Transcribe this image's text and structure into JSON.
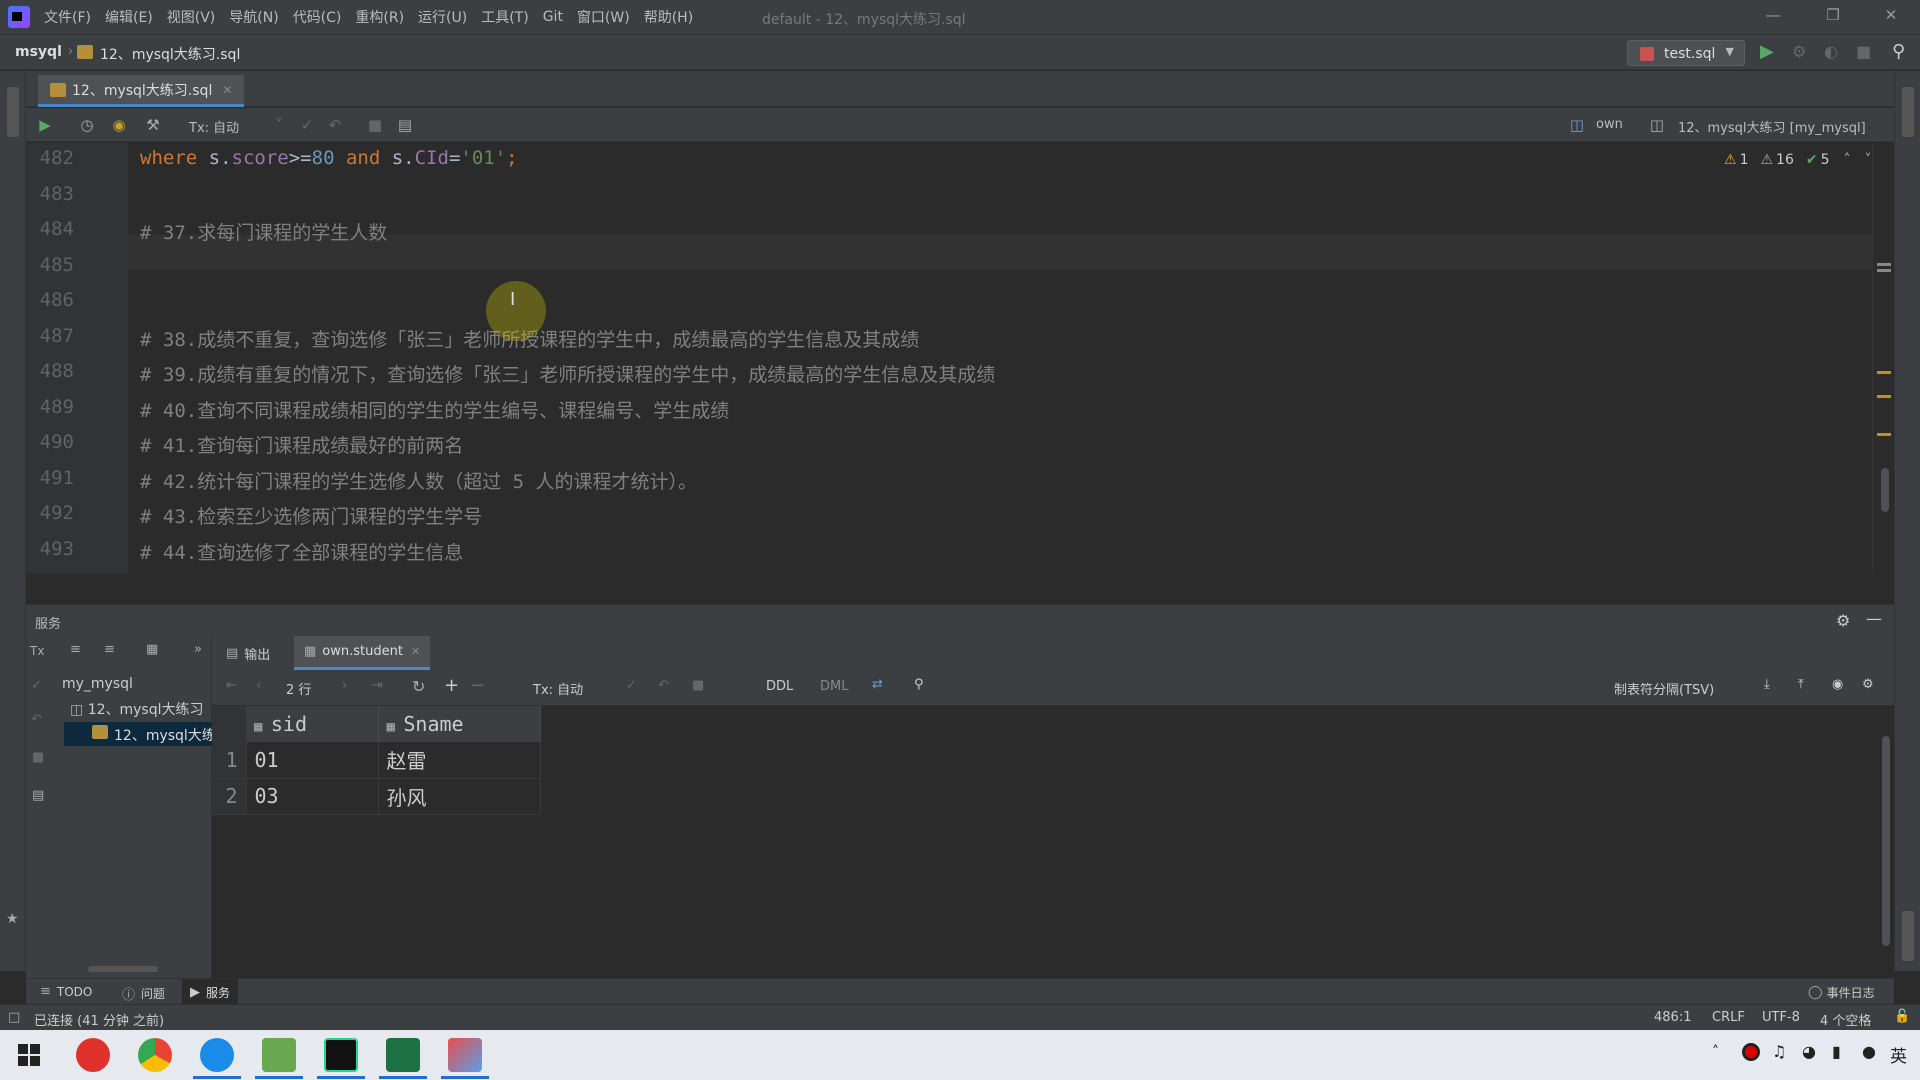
{
  "menubar": {
    "items": [
      "文件(F)",
      "编辑(E)",
      "视图(V)",
      "导航(N)",
      "代码(C)",
      "重构(R)",
      "运行(U)",
      "工具(T)",
      "Git",
      "窗口(W)",
      "帮助(H)"
    ],
    "title": "default - 12、mysql大练习.sql"
  },
  "navbar": {
    "project": "msyql",
    "file": "12、mysql大练习.sql",
    "run_config": "test.sql"
  },
  "tabs": [
    {
      "label": "12、mysql大练习.sql"
    }
  ],
  "editor_toolbar": {
    "tx_mode": "Tx: 自动",
    "schema": "own",
    "console": "12、mysql大练习 [my_mysql]"
  },
  "inspections": {
    "warnings": "1",
    "weak_warnings": "16",
    "ok": "5"
  },
  "editor": {
    "lines": [
      {
        "n": "482",
        "segments": [
          {
            "t": "where ",
            "c": "kw"
          },
          {
            "t": "s.",
            "c": "plain"
          },
          {
            "t": "score",
            "c": "fld"
          },
          {
            "t": ">=",
            "c": "plain"
          },
          {
            "t": "80",
            "c": "num"
          },
          {
            "t": " and ",
            "c": "kw"
          },
          {
            "t": "s.",
            "c": "plain"
          },
          {
            "t": "CId",
            "c": "fld"
          },
          {
            "t": "=",
            "c": "plain"
          },
          {
            "t": "'01'",
            "c": "str"
          },
          {
            "t": ";",
            "c": "kw"
          }
        ]
      },
      {
        "n": "483",
        "segments": []
      },
      {
        "n": "484",
        "segments": [
          {
            "t": "# 37.求每门课程的学生人数",
            "c": "cmt"
          }
        ]
      },
      {
        "n": "485",
        "segments": []
      },
      {
        "n": "486",
        "segments": []
      },
      {
        "n": "487",
        "segments": [
          {
            "t": "# 38.成绩不重复，查询选修「张三」老师所授课程的学生中，成绩最高的学生信息及其成绩",
            "c": "cmt"
          }
        ]
      },
      {
        "n": "488",
        "segments": [
          {
            "t": "# 39.成绩有重复的情况下，查询选修「张三」老师所授课程的学生中，成绩最高的学生信息及其成绩",
            "c": "cmt"
          }
        ]
      },
      {
        "n": "489",
        "segments": [
          {
            "t": "# 40.查询不同课程成绩相同的学生的学生编号、课程编号、学生成绩",
            "c": "cmt"
          }
        ]
      },
      {
        "n": "490",
        "segments": [
          {
            "t": "# 41.查询每门课程成绩最好的前两名",
            "c": "cmt"
          }
        ]
      },
      {
        "n": "491",
        "segments": [
          {
            "t": "# 42.统计每门课程的学生选修人数（超过 5 人的课程才统计）。",
            "c": "cmt"
          }
        ]
      },
      {
        "n": "492",
        "segments": [
          {
            "t": "# 43.检索至少选修两门课程的学生学号",
            "c": "cmt"
          }
        ]
      },
      {
        "n": "493",
        "segments": [
          {
            "t": "# 44.查询选修了全部课程的学生信息",
            "c": "cmt"
          }
        ]
      }
    ]
  },
  "services": {
    "title": "服务",
    "tree": {
      "root": "my_mysql",
      "child": "12、mysql大练习",
      "leaf": "12、mysql大练"
    },
    "tabs": {
      "output": "输出",
      "table": "own.student"
    },
    "grid_toolbar": {
      "rows": "2 行",
      "tx": "Tx: 自动",
      "ddl": "DDL",
      "dml": "DML",
      "format": "制表符分隔(TSV)"
    },
    "columns": [
      "sid",
      "Sname"
    ],
    "rows": [
      {
        "n": "1",
        "sid": "01",
        "sname": "赵雷"
      },
      {
        "n": "2",
        "sid": "03",
        "sname": "孙风"
      }
    ]
  },
  "toolwindows": {
    "todo": "TODO",
    "problems": "问题",
    "services": "服务",
    "event_log": "事件日志"
  },
  "status": {
    "connection": "已连接 (41 分钟 之前)",
    "position": "486:1",
    "line_sep": "CRLF",
    "encoding": "UTF-8",
    "indent": "4 个空格"
  },
  "taskbar": {
    "ime": "英"
  },
  "colors": {
    "accent": "#4a88c7",
    "keyword": "#cc7832",
    "number": "#6897bb",
    "string": "#6a8759",
    "comment": "#808080"
  }
}
